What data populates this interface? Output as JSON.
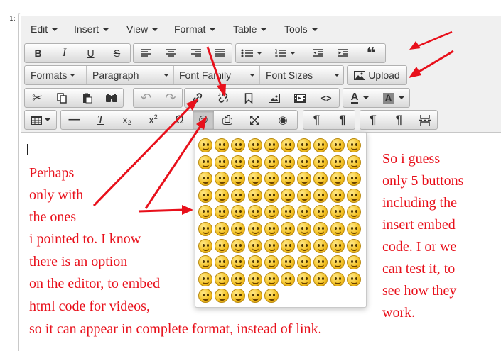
{
  "corner_mark": "1:",
  "menu": {
    "items": [
      "Edit",
      "Insert",
      "View",
      "Format",
      "Table",
      "Tools"
    ]
  },
  "toolbar": {
    "row2": [
      "bold-icon",
      "italic-icon",
      "underline-icon",
      "strikethrough-icon",
      "align-left-icon",
      "align-center-icon",
      "align-right-icon",
      "align-justify-icon",
      "bullet-list-icon",
      "numbered-list-icon",
      "outdent-icon",
      "indent-icon",
      "blockquote-icon"
    ],
    "formats_label": "Formats",
    "paragraph_label": "Paragraph",
    "font_family_label": "Font Family",
    "font_sizes_label": "Font Sizes",
    "upload_label": "Upload",
    "row4": [
      "cut-icon",
      "copy-icon",
      "paste-icon",
      "find-replace-icon",
      "undo-icon",
      "redo-icon",
      "link-icon",
      "unlink-icon",
      "anchor-icon",
      "image-icon",
      "media-icon",
      "code-icon",
      "text-color-icon",
      "background-color-icon"
    ],
    "row5": [
      "table-icon",
      "horizontal-rule-icon",
      "clear-formatting-icon",
      "subscript-icon",
      "superscript-icon",
      "special-character-icon",
      "emoticons-icon",
      "print-icon",
      "fullscreen-icon",
      "preview-icon",
      "ltr-icon",
      "rtl-icon",
      "show-blocks-icon",
      "visual-chars-icon",
      "page-break-icon"
    ]
  },
  "icons": {
    "bold": "B",
    "italic": "I",
    "underline": "U",
    "strike": "S",
    "blockquote": "❝",
    "cut": "✂",
    "undo": "↶",
    "redo": "↷",
    "code": "<>",
    "text_color": "A",
    "bg_color": "A",
    "hr": "—",
    "clear": "T",
    "sub": "x",
    "sub_mark": "2",
    "sup": "x",
    "sup_mark": "2",
    "omega": "Ω",
    "emoticon": "☺",
    "print": "⎙",
    "eye": "◉",
    "ltr": "¶",
    "rtl": "¶",
    "pilcrow": "¶",
    "pilcrow2": "¶"
  },
  "notes": {
    "left": [
      "Perhaps",
      "only with",
      "the ones",
      "i pointed to. I know",
      "there is an option",
      "on the editor, to embed",
      "html code for videos,",
      "so it can appear in complete format, instead of link."
    ],
    "right": [
      "So i guess",
      "only 5 buttons",
      "including the",
      "insert embed",
      "code. I or we",
      "can test it, to",
      "see how they",
      "work."
    ]
  },
  "emoticons": {
    "rows": 10,
    "cols": 10,
    "last_row_count": 5
  },
  "colors": {
    "annotation": "#e8101b",
    "toolbar_bg": "#f0f0f0"
  }
}
